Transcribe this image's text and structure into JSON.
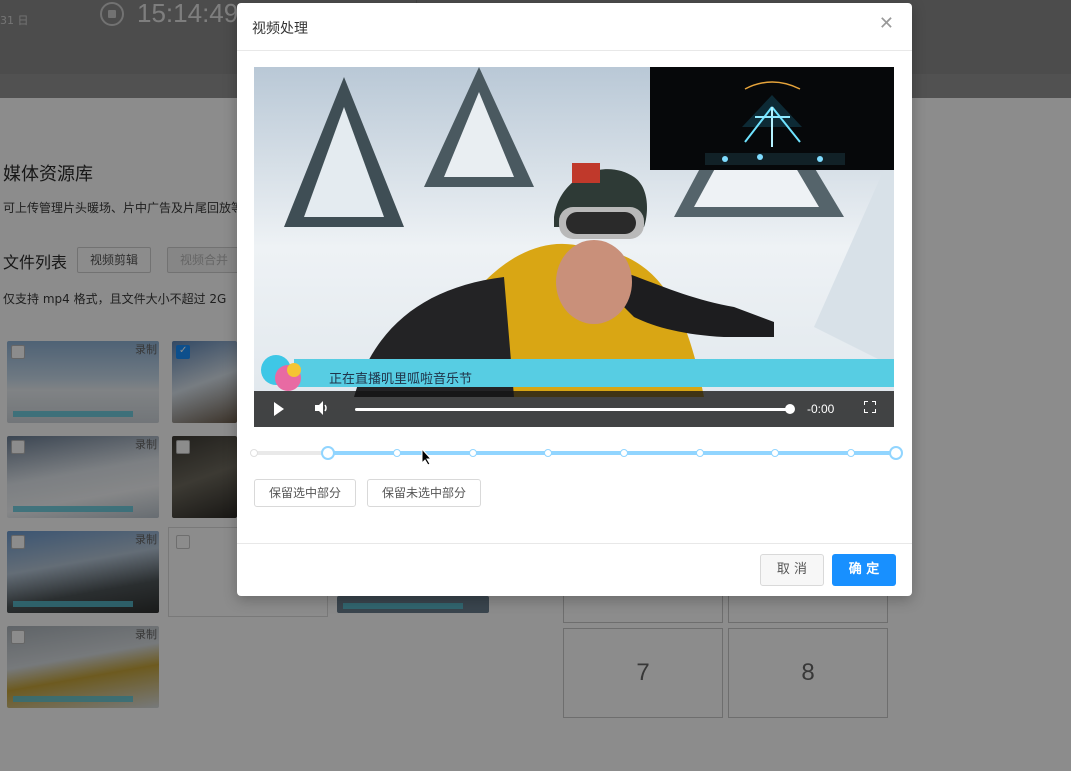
{
  "background": {
    "date_fragment": "31 日",
    "clock": "15:14:49",
    "library_title": "媒体资源库",
    "library_desc": "可上传管理片头暖场、片中广告及片尾回放等",
    "file_list_label": "文件列表",
    "btn_video_edit": "视频剪辑",
    "btn_video_merge": "视频合并",
    "upload_hint": "仅支持 mp4 格式，且文件大小不超过 2G",
    "record_tag": "录制",
    "grid_cells": [
      "7",
      "8"
    ]
  },
  "modal": {
    "title": "视频处理",
    "close_icon": "close-icon",
    "video": {
      "banner_text": "正在直播叽里呱啦音乐节",
      "time": "-0:00",
      "progress": 1.0
    },
    "buttons": {
      "keep_selected": "保留选中部分",
      "keep_unselected": "保留未选中部分"
    },
    "footer": {
      "cancel": "取 消",
      "ok": "确 定"
    }
  },
  "colors": {
    "primary": "#1890ff",
    "slider": "#91d5ff",
    "banner": "#57c9dd"
  }
}
